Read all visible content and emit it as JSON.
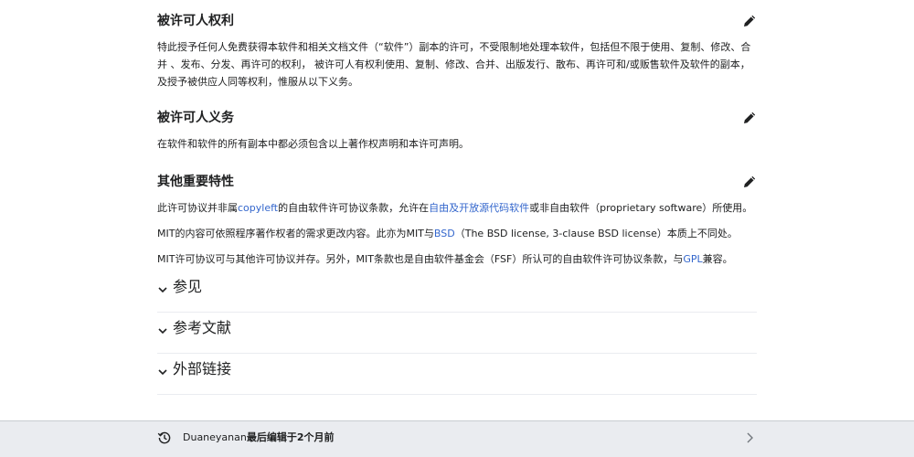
{
  "sections": [
    {
      "title": "被许可人权利",
      "paragraphs": [
        [
          "特此授予任何人免费获得本软件和相关文档文件（“软件”）副本的许可，不受限制地处理本软件，包括但不限于使用、复制、修改、合并 、发布、分发、再许可的权利， 被许可人有权利使用、复制、修改、合并、出版发行、散布、再许可和/或贩售软件及软件的副本，及授予被供应人同等权利，惟服从以下义务。"
        ]
      ]
    },
    {
      "title": "被许可人义务",
      "paragraphs": [
        [
          "在软件和软件的所有副本中都必须包含以上著作权声明和本许可声明。"
        ]
      ]
    },
    {
      "title": "其他重要特性",
      "paragraphs": [
        [
          "此许可协议并非属",
          "copyleft",
          "的自由软件许可协议条款，允许在",
          "自由及开放源代码软件",
          "或非自由软件（proprietary software）所使用。"
        ],
        [
          "MIT的内容可依照程序著作权者的需求更改内容。此亦为MIT与",
          "BSD",
          "（The BSD license, 3-clause BSD license）本质上不同处。"
        ],
        [
          "MIT许可协议可与其他许可协议并存。另外，MIT条款也是自由软件基金会（FSF）所认可的自由软件许可协议条款，与",
          "GPL",
          "兼容。"
        ]
      ]
    }
  ],
  "collapsibles": [
    {
      "title": "参见"
    },
    {
      "title": "参考文献"
    },
    {
      "title": "外部链接"
    }
  ],
  "footer": {
    "user": "Duaneyanan",
    "text": "最后编辑于2个月前"
  },
  "icons": {
    "edit": "pencil-icon",
    "history": "history-icon",
    "chevron_right": "chevron-right-icon",
    "chevron_down": "chevron-down-icon"
  },
  "colors": {
    "link": "#3366cc",
    "footer_bg": "#eaecf0"
  }
}
